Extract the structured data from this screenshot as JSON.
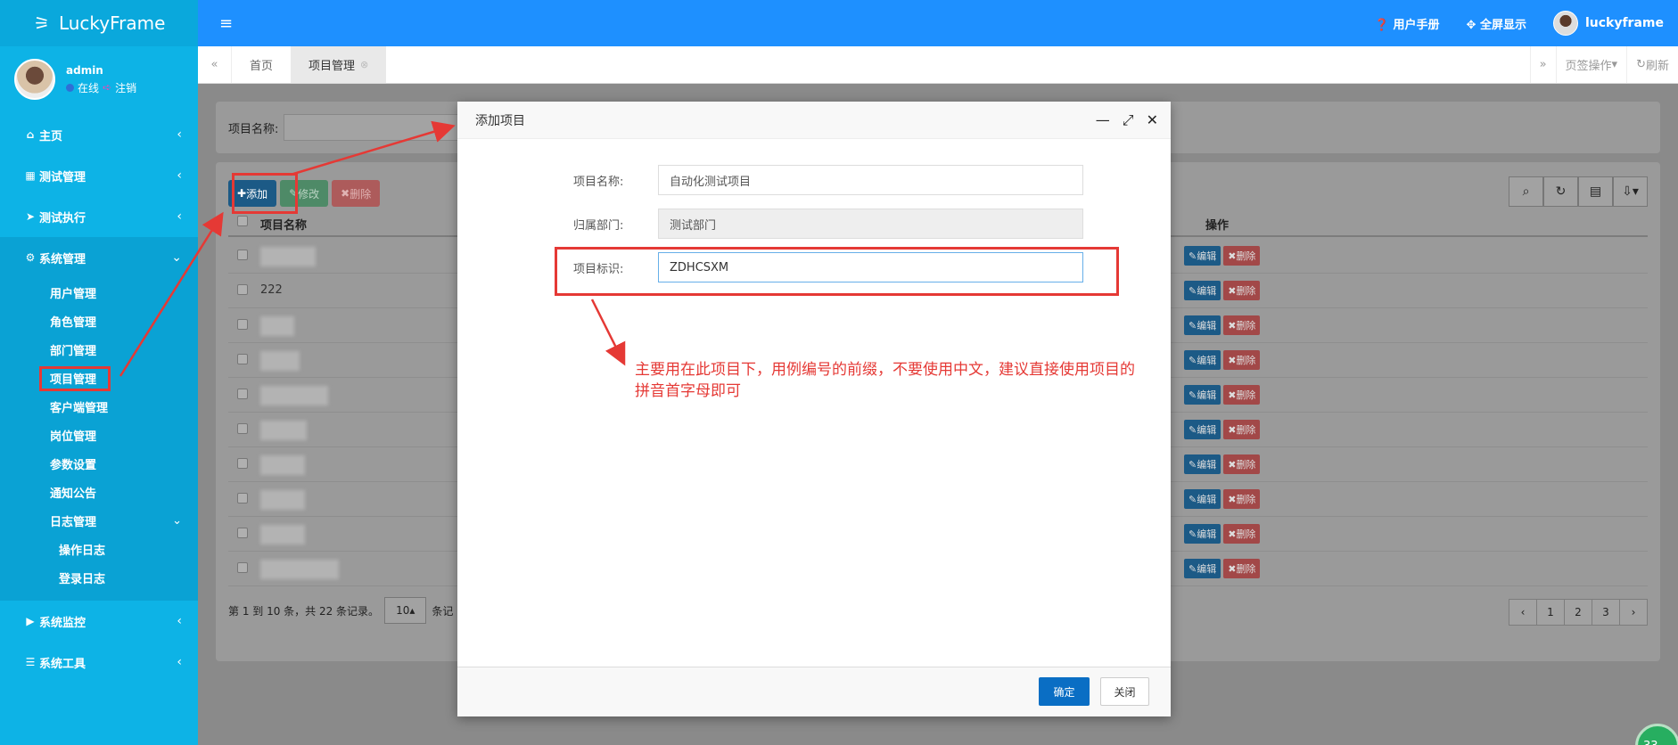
{
  "app": {
    "logo": "LuckyFrame"
  },
  "user_panel": {
    "name": "admin",
    "status_online": "在线",
    "logout": "注销"
  },
  "sidebar": {
    "items": [
      {
        "icon": "home-icon",
        "glyph": "⌂",
        "label": "主页"
      },
      {
        "icon": "grid-icon",
        "glyph": "▦",
        "label": "测试管理"
      },
      {
        "icon": "send-icon",
        "glyph": "➤",
        "label": "测试执行"
      },
      {
        "icon": "gear-icon",
        "glyph": "⚙",
        "label": "系统管理"
      },
      {
        "icon": "video-icon",
        "glyph": "▶",
        "label": "系统监控"
      },
      {
        "icon": "bars-icon",
        "glyph": "☰",
        "label": "系统工具"
      }
    ],
    "system_sub": [
      "用户管理",
      "角色管理",
      "部门管理",
      "项目管理",
      "客户端管理",
      "岗位管理",
      "参数设置",
      "通知公告",
      "日志管理"
    ],
    "log_sub": [
      "操作日志",
      "登录日志"
    ]
  },
  "topbar": {
    "manual": "用户手册",
    "fullscreen": "全屏显示",
    "username": "luckyframe"
  },
  "tabs": {
    "items": [
      "首页",
      "项目管理"
    ],
    "page_ops": "页签操作",
    "refresh": "刷新"
  },
  "search": {
    "label": "项目名称:"
  },
  "toolbar": {
    "add": "添加",
    "edit": "修改",
    "delete": "删除"
  },
  "table": {
    "headers": [
      "项目名称",
      "操作"
    ],
    "rows": [
      "",
      "222",
      "",
      "",
      "",
      "",
      "",
      "",
      "",
      ""
    ],
    "edit": "编辑",
    "delete": "删除"
  },
  "pager": {
    "info": "第 1 到 10 条，共 22 条记录。",
    "page_size": "10",
    "per_page_suffix": "条记",
    "pages": [
      "‹",
      "1",
      "2",
      "3",
      "›"
    ]
  },
  "badge": "33",
  "modal": {
    "title": "添加项目",
    "fields": [
      {
        "label": "项目名称:",
        "value": "自动化测试项目"
      },
      {
        "label": "归属部门:",
        "value": "测试部门"
      },
      {
        "label": "项目标识:",
        "value": "ZDHCSXM"
      }
    ],
    "annotation": "主要用在此项目下，用例编号的前缀，不要使用中文，建议直接使用项目的拼音首字母即可",
    "ok": "确定",
    "close": "关闭"
  },
  "colors": {
    "sidebar": "#0db3e6",
    "topbar": "#1e90ff",
    "annotation_red": "#e53935",
    "primary_button": "#0a6ec4"
  }
}
